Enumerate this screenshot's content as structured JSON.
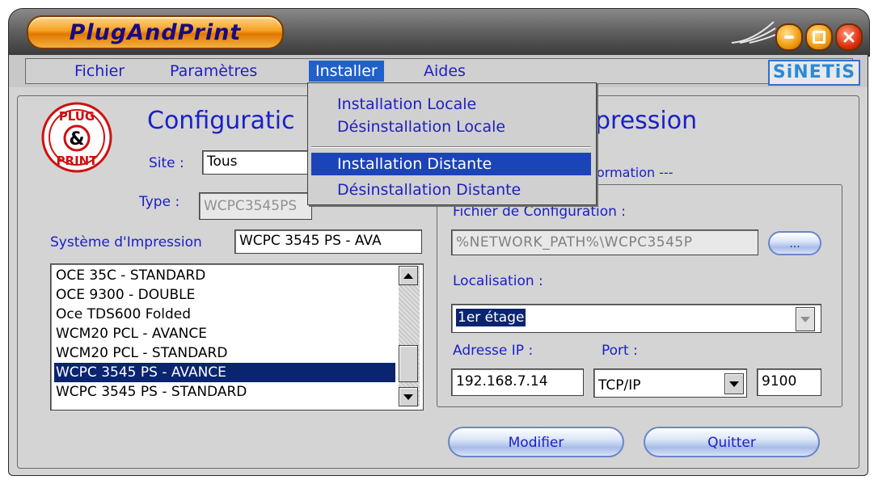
{
  "window": {
    "title": "PlugAndPrint",
    "controls": [
      "minimize-icon",
      "maximize-icon",
      "close-icon"
    ]
  },
  "menubar": {
    "items": [
      {
        "label": "Fichier"
      },
      {
        "label": "Paramètres"
      },
      {
        "label": "Installer",
        "active": true
      },
      {
        "label": "Aides"
      }
    ],
    "brand": "SiNETiS"
  },
  "installer_menu": {
    "items": [
      {
        "label": "Installation Locale"
      },
      {
        "label": "Désinstallation Locale"
      },
      {
        "label": "Installation Distante",
        "highlighted": true
      },
      {
        "label": "Désinstallation Distante"
      }
    ]
  },
  "header": {
    "title_left": "Configuratic",
    "title_right": "pression",
    "logo_lines": [
      "PLUG",
      "&",
      "PRINT"
    ]
  },
  "form": {
    "site_label": "Site :",
    "site_value": "Tous",
    "type_label": "Type :",
    "type_value": "WCPC3545PS",
    "systeme_label": "Système d'Impression",
    "systeme_value": "WCPC 3545 PS - AVA"
  },
  "printer_list": {
    "rows": [
      "OCE 35C - STANDARD",
      "OCE 9300 - DOUBLE",
      "Oce TDS600 Folded",
      "WCM20 PCL - AVANCE",
      "WCM20 PCL - STANDARD",
      "WCPC 3545 PS - AVANCE",
      "WCPC 3545 PS - STANDARD"
    ],
    "selected": "WCPC 3545 PS - AVANCE"
  },
  "info_group": {
    "legend": "ormation ---",
    "fichier_label": "Fichier de Configuration :",
    "fichier_value": "%NETWORK_PATH%\\WCPC3545P",
    "browse_label": "...",
    "localisation_label": "Localisation :",
    "localisation_value": "1er étage",
    "ip_label": "Adresse IP :",
    "ip_value": "192.168.7.14",
    "port_label": "Port :",
    "port_type": "TCP/IP",
    "port_number": "9100"
  },
  "buttons": {
    "modifier": "Modifier",
    "quitter": "Quitter"
  },
  "colors": {
    "accent_blue": "#1a20c8",
    "menu_highlight": "#1a44b8",
    "selection": "#0a2470",
    "title_orange": "#f09a10"
  }
}
